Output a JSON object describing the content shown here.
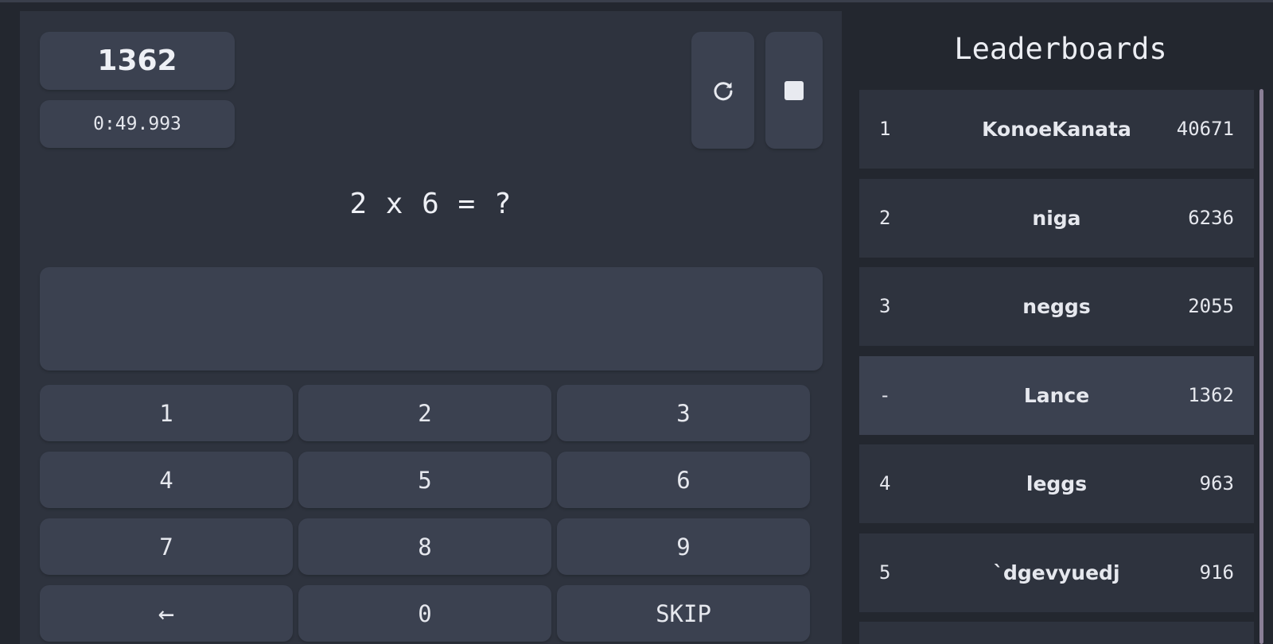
{
  "game": {
    "score": "1362",
    "timer": "0:49.993",
    "question": "2 x 6 = ?",
    "answer_value": "",
    "keys": [
      "1",
      "2",
      "3",
      "4",
      "5",
      "6",
      "7",
      "8",
      "9",
      "←",
      "0",
      "SKIP"
    ],
    "restart_icon": "restart-icon",
    "stop_icon": "stop-icon"
  },
  "leaderboard": {
    "title": "Leaderboards",
    "rows": [
      {
        "rank": "1",
        "name": "KonoeKanata",
        "score": "40671"
      },
      {
        "rank": "2",
        "name": "niga",
        "score": "6236"
      },
      {
        "rank": "3",
        "name": "neggs",
        "score": "2055"
      },
      {
        "rank": "-",
        "name": "Lance",
        "score": "1362"
      },
      {
        "rank": "4",
        "name": "leggs",
        "score": "963"
      },
      {
        "rank": "5",
        "name": "`dgevyuedj",
        "score": "916"
      }
    ]
  },
  "colors": {
    "background": "#23272f",
    "panel": "#2e333e",
    "card": "#3b4150",
    "scrollbar": "#8a7f96"
  }
}
